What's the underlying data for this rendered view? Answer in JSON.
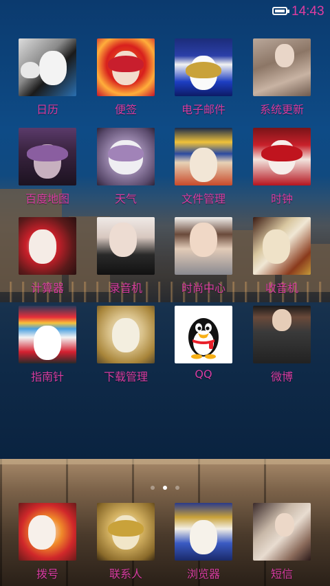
{
  "status_bar": {
    "time": "14:43",
    "battery_icon": "battery-icon"
  },
  "colors": {
    "label": "#d63ca0",
    "clock": "#e03ca0"
  },
  "apps": [
    {
      "label": "日历",
      "icon": "masked-couple-icon"
    },
    {
      "label": "便签",
      "icon": "feathered-mask-icon"
    },
    {
      "label": "电子邮件",
      "icon": "blue-hat-mask-icon"
    },
    {
      "label": "系统更新",
      "icon": "gowned-woman-icon"
    },
    {
      "label": "百度地图",
      "icon": "purple-mask-woman-icon"
    },
    {
      "label": "天气",
      "icon": "silver-mask-icon"
    },
    {
      "label": "文件管理",
      "icon": "pirate-hat-mask-icon"
    },
    {
      "label": "时钟",
      "icon": "red-mask-icon"
    },
    {
      "label": "计算器",
      "icon": "red-hair-mask-icon"
    },
    {
      "label": "录音机",
      "icon": "feather-mask-woman-icon"
    },
    {
      "label": "时尚中心",
      "icon": "fashion-woman-icon"
    },
    {
      "label": "收音机",
      "icon": "gold-mask-icon"
    },
    {
      "label": "指南针",
      "icon": "pompom-jester-icon"
    },
    {
      "label": "下载管理",
      "icon": "gold-white-mask-icon"
    },
    {
      "label": "QQ",
      "icon": "qq-penguin-icon"
    },
    {
      "label": "微博",
      "icon": "black-dress-woman-icon"
    }
  ],
  "pager": {
    "pages": 3,
    "active": 2
  },
  "dock": [
    {
      "label": "拨号",
      "icon": "orange-jester-icon"
    },
    {
      "label": "联系人",
      "icon": "golden-mask-icon"
    },
    {
      "label": "浏览器",
      "icon": "blue-costume-icon"
    },
    {
      "label": "短信",
      "icon": "fan-woman-icon"
    }
  ]
}
